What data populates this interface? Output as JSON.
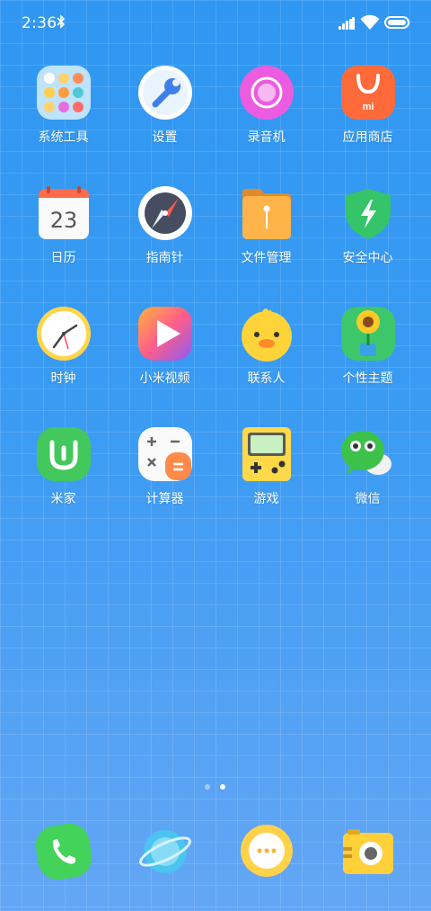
{
  "status": {
    "time": "2:36"
  },
  "apps": [
    {
      "id": "system-tools",
      "label": "系统工具",
      "icon": "folder-icon"
    },
    {
      "id": "settings",
      "label": "设置",
      "icon": "wrench-icon"
    },
    {
      "id": "recorder",
      "label": "录音机",
      "icon": "record-icon"
    },
    {
      "id": "app-store",
      "label": "应用商店",
      "icon": "shopping-bag-icon"
    },
    {
      "id": "calendar",
      "label": "日历",
      "icon": "calendar-icon",
      "date": "23"
    },
    {
      "id": "compass",
      "label": "指南针",
      "icon": "compass-icon"
    },
    {
      "id": "file-manager",
      "label": "文件管理",
      "icon": "folder-file-icon"
    },
    {
      "id": "security",
      "label": "安全中心",
      "icon": "shield-icon"
    },
    {
      "id": "clock",
      "label": "时钟",
      "icon": "clock-icon"
    },
    {
      "id": "mi-video",
      "label": "小米视频",
      "icon": "play-icon"
    },
    {
      "id": "contacts",
      "label": "联系人",
      "icon": "duck-icon"
    },
    {
      "id": "themes",
      "label": "个性主题",
      "icon": "sunflower-icon"
    },
    {
      "id": "mi-home",
      "label": "米家",
      "icon": "mijia-icon"
    },
    {
      "id": "calculator",
      "label": "计算器",
      "icon": "calculator-icon"
    },
    {
      "id": "games",
      "label": "游戏",
      "icon": "gameboy-icon"
    },
    {
      "id": "wechat",
      "label": "微信",
      "icon": "wechat-icon"
    }
  ],
  "pager": {
    "pages": 2,
    "current": 2
  },
  "dock": [
    {
      "id": "phone",
      "icon": "phone-icon"
    },
    {
      "id": "browser",
      "icon": "planet-icon"
    },
    {
      "id": "messages",
      "icon": "message-icon"
    },
    {
      "id": "camera",
      "icon": "camera-icon"
    }
  ]
}
